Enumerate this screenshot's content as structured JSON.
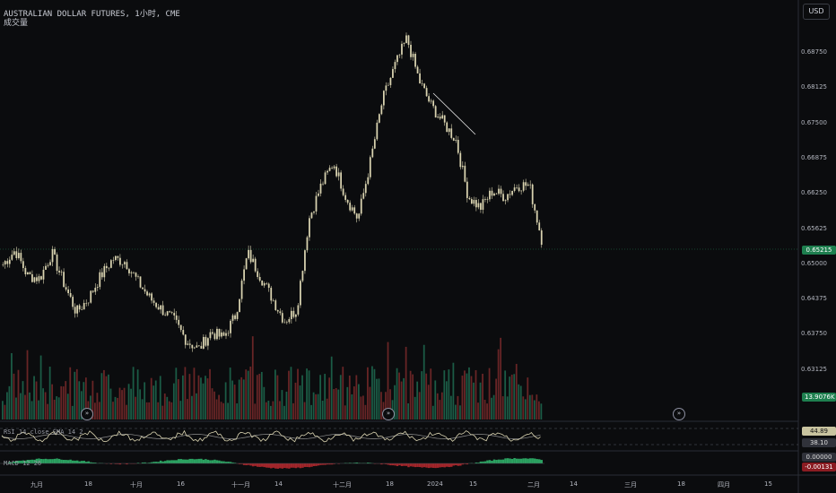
{
  "header": {
    "title": "AUSTRALIAN DOLLAR FUTURES, 1小时, CME",
    "volume_label": "成交量",
    "currency": "USD"
  },
  "price_axis": {
    "ticks": [
      "0.68750",
      "0.68125",
      "0.67500",
      "0.66875",
      "0.66250",
      "0.65625",
      "0.65000",
      "0.64375",
      "0.63750",
      "0.63125"
    ],
    "current_price": "0.65215",
    "volume_value": "13.9076K"
  },
  "indicators": {
    "rsi": {
      "label": "RSI 14 close SMA 14 2",
      "value_primary": "44.89",
      "value_secondary": "38.10"
    },
    "macd": {
      "label": "MACD 12 26",
      "value_zero": "0.00000",
      "value": "-0.00131"
    }
  },
  "time_axis": {
    "labels": [
      "九月",
      "18",
      "十月",
      "16",
      "十一月",
      "14",
      "十二月",
      "18",
      "2024",
      "15",
      "二月",
      "14",
      "三月",
      "18",
      "四月",
      "15"
    ]
  },
  "colors": {
    "background": "#0b0c0e",
    "candle_up": "#d9d3b0",
    "candle_down": "#d9d3b0",
    "volume_up": "#1f6b50",
    "volume_down": "#7a2a2a",
    "price_badge": "#1e7f4f",
    "macd_positive": "#2fb36a",
    "macd_negative": "#b3282e",
    "rsi_line": "#d9d3b0"
  },
  "chart_data": {
    "type": "candlestick",
    "series": [
      {
        "name": "AUSTRALIAN DOLLAR FUTURES",
        "values": [
          0.648,
          0.6505,
          0.646,
          0.6455,
          0.65,
          0.6445,
          0.6395,
          0.642,
          0.646,
          0.649,
          0.6485,
          0.645,
          0.642,
          0.64,
          0.638,
          0.6345,
          0.633,
          0.636,
          0.635,
          0.639,
          0.65,
          0.646,
          0.642,
          0.638,
          0.64,
          0.656,
          0.662,
          0.666,
          0.66,
          0.656,
          0.666,
          0.677,
          0.683,
          0.688,
          0.6805,
          0.676,
          0.673,
          0.67,
          0.66,
          0.658,
          0.661,
          0.66,
          0.662,
          0.662,
          0.6525
        ]
      }
    ],
    "ylim": [
      0.625,
      0.69
    ]
  }
}
